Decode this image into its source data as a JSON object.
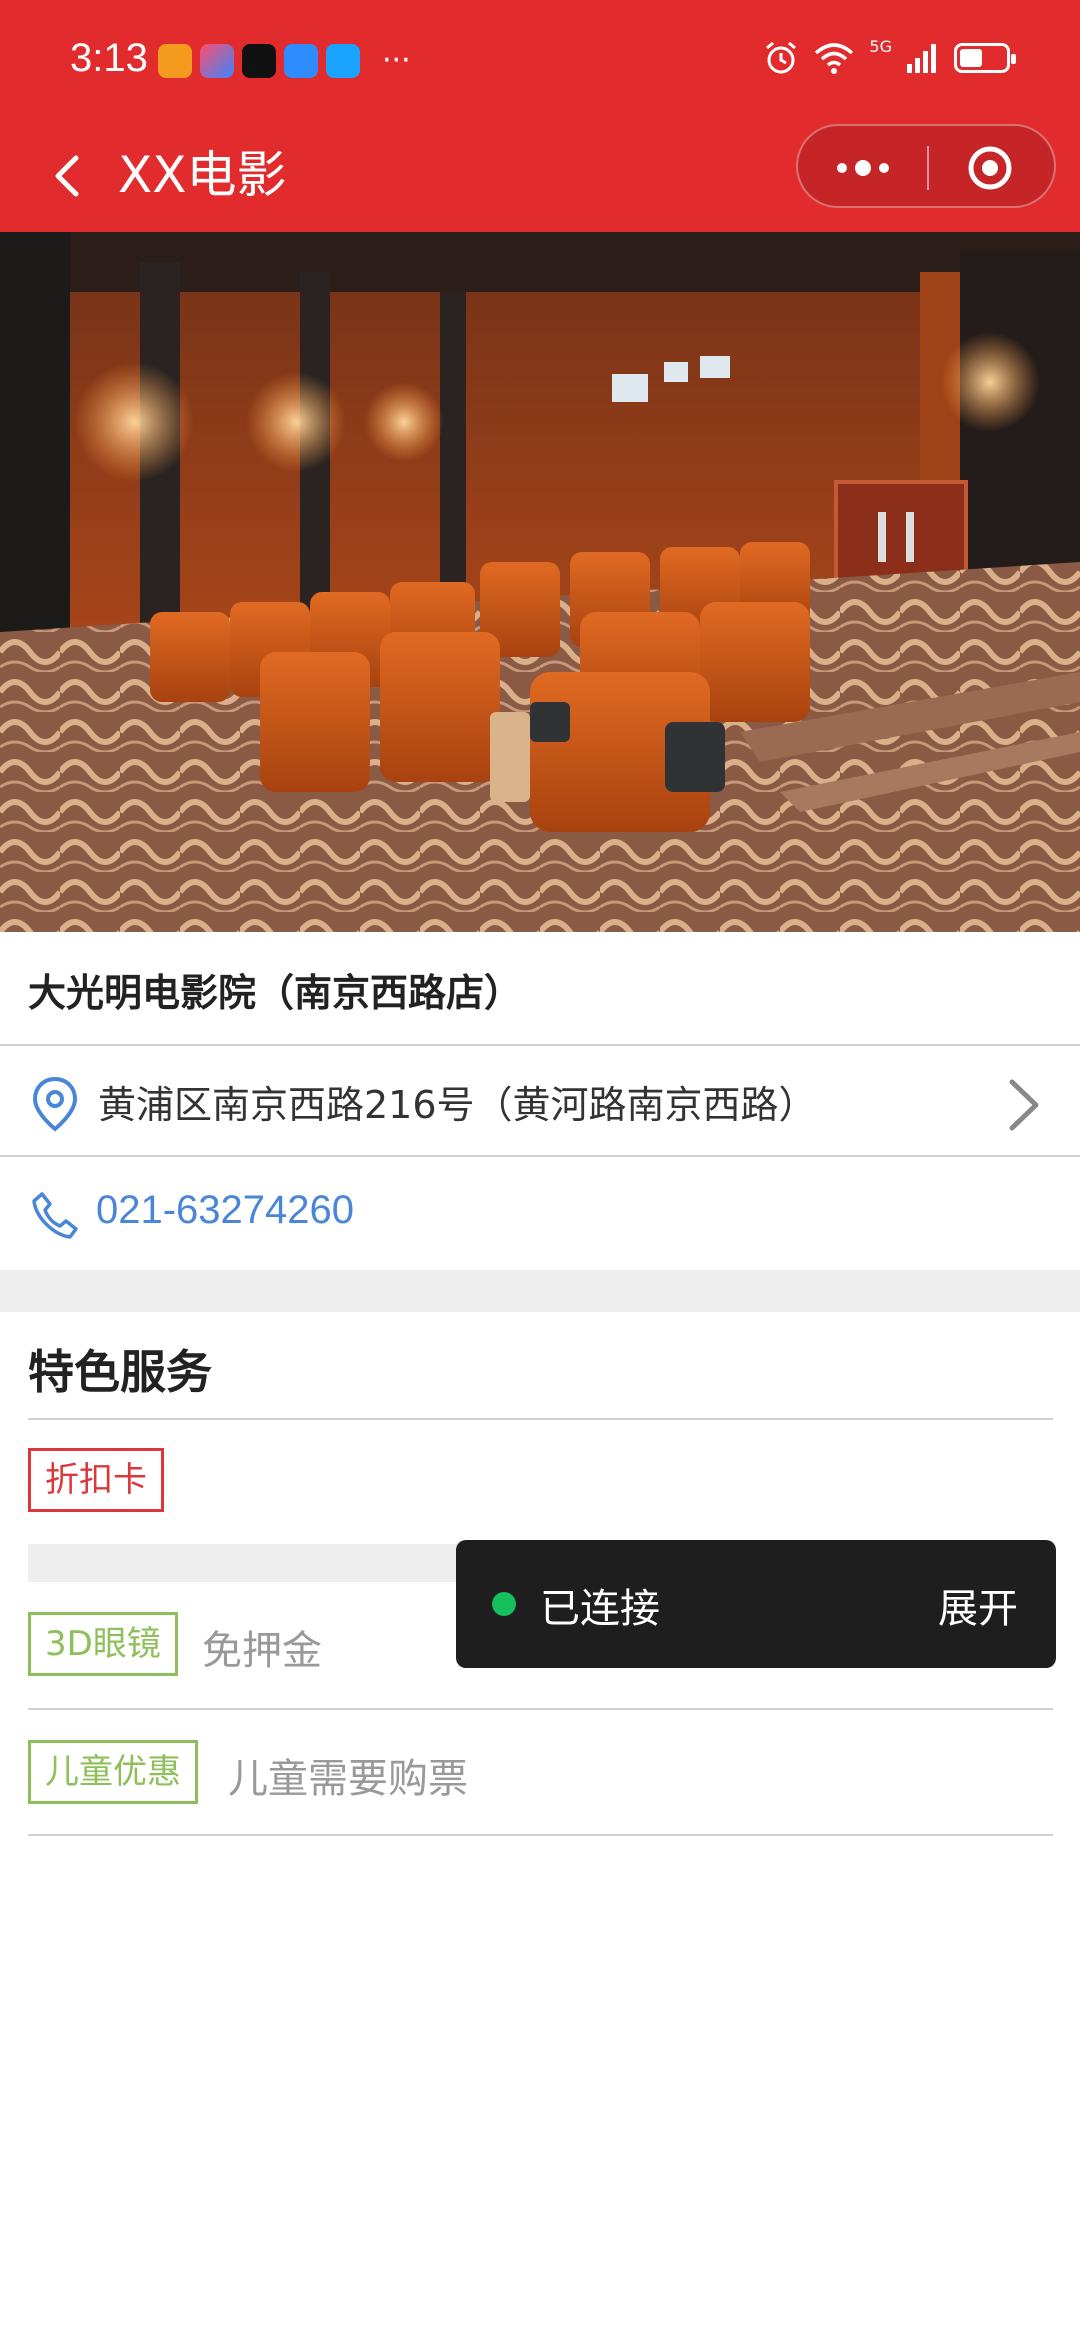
{
  "status_bar": {
    "time": "3:13",
    "network": "5G",
    "battery_level": 0.5,
    "app_icon_colors": [
      "#f39a1f",
      "#3a86ff",
      "#111111",
      "#2f8cff",
      "#1aa3ff"
    ]
  },
  "nav": {
    "title": "XX电影"
  },
  "cinema": {
    "name": "大光明电影院（南京西路店）",
    "address": "黄浦区南京西路216号（黄河路南京西路）",
    "phone": "021-63274260"
  },
  "services": {
    "title": "特色服务",
    "items": [
      {
        "tag": "折扣卡",
        "desc": ""
      },
      {
        "tag": "3D眼镜",
        "desc": "免押金"
      },
      {
        "tag": "儿童优惠",
        "desc": "儿童需要购票"
      }
    ]
  },
  "toast": {
    "status": "已连接",
    "action": "展开"
  },
  "colors": {
    "brand_red": "#e12b2d",
    "link_blue": "#4a86d8",
    "tag_red": "#d9393b",
    "tag_green": "#8fbf5a",
    "connected_green": "#14c05c"
  }
}
